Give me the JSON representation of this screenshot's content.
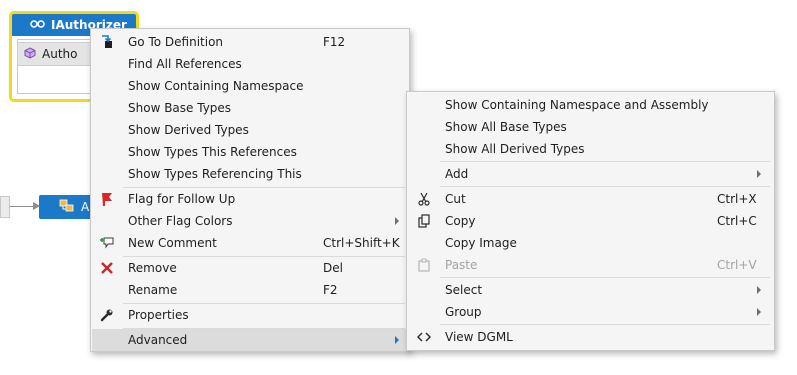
{
  "canvas": {
    "node1": {
      "title": "IAuthorizer",
      "title_icon": "interface-icon",
      "member_label": "Autho",
      "member_icon": "member-icon",
      "border_color": "#f2d91a",
      "header_color": "#1c79c8"
    },
    "node2": {
      "label": "A",
      "icon": "class-icon",
      "color": "#1c79c8"
    }
  },
  "context_menu": {
    "items": [
      {
        "label": "Go To Definition",
        "shortcut": "F12",
        "icon": "go-to-definition-icon"
      },
      {
        "label": "Find All References",
        "shortcut": ""
      },
      {
        "label": "Show Containing Namespace",
        "shortcut": ""
      },
      {
        "label": "Show Base Types",
        "shortcut": ""
      },
      {
        "label": "Show Derived Types",
        "shortcut": ""
      },
      {
        "label": "Show Types This References",
        "shortcut": ""
      },
      {
        "label": "Show Types Referencing This",
        "shortcut": ""
      },
      {
        "label": "Flag for Follow Up",
        "shortcut": "",
        "icon": "flag-icon"
      },
      {
        "label": "Other Flag Colors",
        "shortcut": "",
        "submenu": true
      },
      {
        "label": "New Comment",
        "shortcut": "Ctrl+Shift+K",
        "icon": "comment-icon"
      },
      {
        "label": "Remove",
        "shortcut": "Del",
        "icon": "remove-icon"
      },
      {
        "label": "Rename",
        "shortcut": "F2"
      },
      {
        "label": "Properties",
        "shortcut": "",
        "icon": "wrench-icon"
      },
      {
        "label": "Advanced",
        "shortcut": "",
        "submenu": true,
        "highlighted": true
      }
    ]
  },
  "advanced_submenu": {
    "items": [
      {
        "label": "Show Containing Namespace and Assembly",
        "shortcut": ""
      },
      {
        "label": "Show All Base Types",
        "shortcut": ""
      },
      {
        "label": "Show All Derived Types",
        "shortcut": ""
      },
      {
        "label": "Add",
        "shortcut": "",
        "submenu": true
      },
      {
        "label": "Cut",
        "shortcut": "Ctrl+X",
        "icon": "scissors-icon"
      },
      {
        "label": "Copy",
        "shortcut": "Ctrl+C",
        "icon": "copy-icon"
      },
      {
        "label": "Copy Image",
        "shortcut": ""
      },
      {
        "label": "Paste",
        "shortcut": "Ctrl+V",
        "icon": "clipboard-icon",
        "disabled": true
      },
      {
        "label": "Select",
        "shortcut": "",
        "submenu": true
      },
      {
        "label": "Group",
        "shortcut": "",
        "submenu": true
      },
      {
        "label": "View DGML",
        "shortcut": "",
        "icon": "code-icon"
      }
    ]
  },
  "colors": {
    "accent": "#1c79c8",
    "highlight": "#dcdcdc",
    "flag": "#d9262a",
    "remove": "#c8262a",
    "menu_bg": "#f5f5f5"
  }
}
